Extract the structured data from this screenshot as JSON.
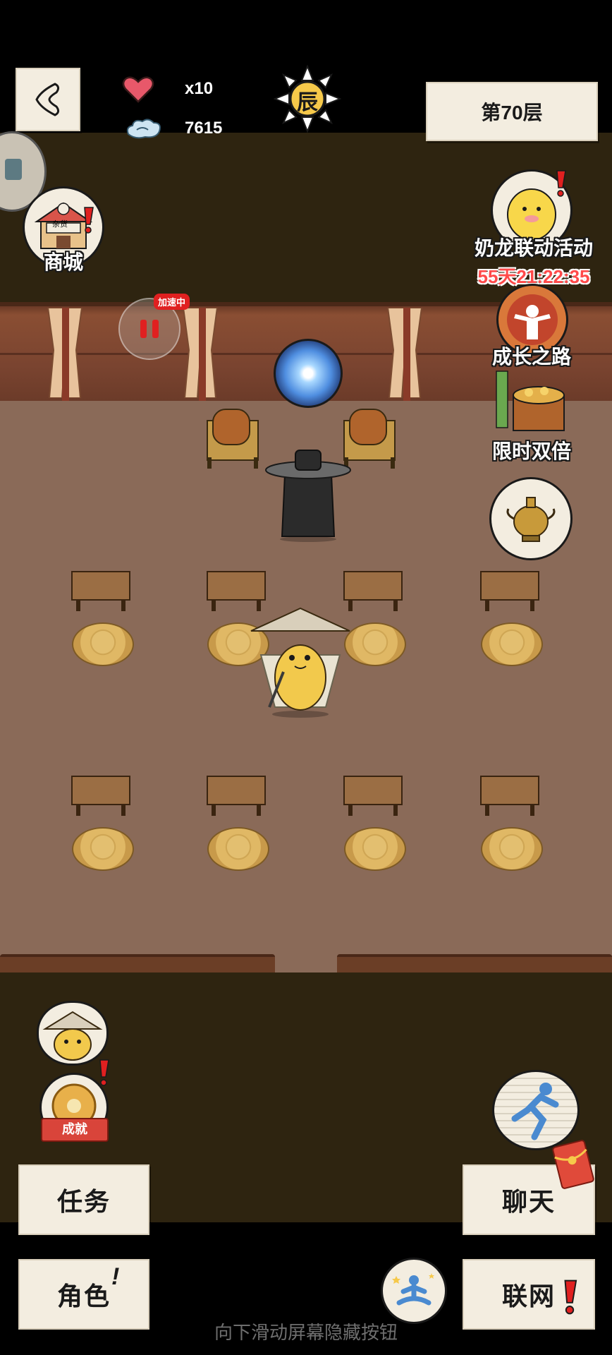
{
  "hud": {
    "lives": "x10",
    "spirit": "7615",
    "time_badge": "辰",
    "floor_label": "第70层"
  },
  "left_menu": {
    "shop_sign": "杂货",
    "shop_label": "商城",
    "speed_badge": "加速中"
  },
  "right_menu": {
    "event_label": "奶龙联动活动",
    "event_timer": "55天21:22:35",
    "growth_label": "成长之路",
    "double_label": "限时双倍"
  },
  "lower_left": {
    "achievement_ribbon": "成就"
  },
  "buttons": {
    "task": "任务",
    "chat": "聊天",
    "character": "角色",
    "network": "联网"
  },
  "hint": "向下滑动屏幕隐藏按钮",
  "colors": {
    "paper": "#f3ede0",
    "floor": "#8a6a58",
    "wall": "#7a4430",
    "dark_band": "#2e2410",
    "alert_red": "#e02020",
    "timer_red": "#ff4a4a"
  },
  "icons": [
    "back-arrow-icon",
    "heart-icon",
    "cloud-icon",
    "sun-badge-icon",
    "shop-icon",
    "pause-icon",
    "portal-icon",
    "nailong-icon",
    "growth-icon",
    "treasure-icon",
    "incense-burner-icon",
    "runner-icon",
    "meditation-icon",
    "red-envelope-icon",
    "exclamation-icon"
  ]
}
